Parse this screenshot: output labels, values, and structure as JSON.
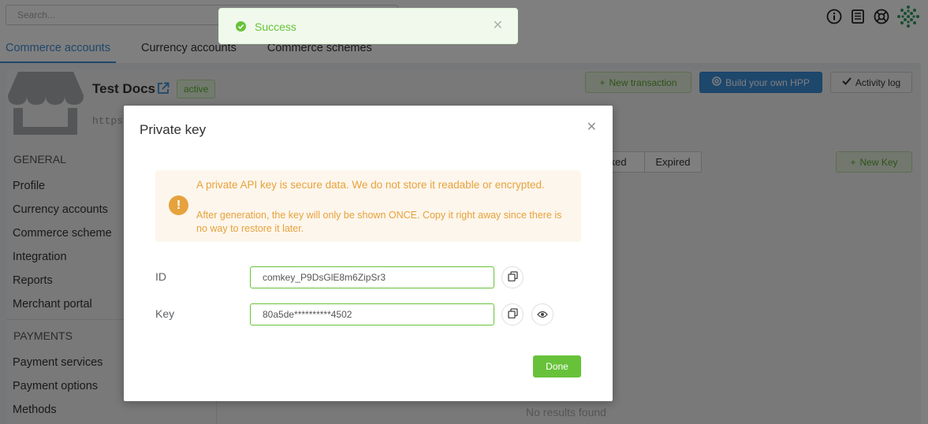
{
  "search": {
    "placeholder": "Search..."
  },
  "top_icons": [
    "info-icon",
    "book-icon",
    "lifebuoy-icon",
    "logo-icon"
  ],
  "tabs": [
    {
      "label": "Commerce accounts",
      "active": true
    },
    {
      "label": "Currency accounts",
      "active": false
    },
    {
      "label": "Commerce schemes",
      "active": false
    }
  ],
  "account": {
    "name": "Test Docs",
    "status": "active",
    "url_fragment": "https"
  },
  "actions": {
    "new_transaction": "New transaction",
    "build_hpp": "Build your own HPP",
    "activity_log": "Activity log"
  },
  "sidebar": {
    "general_title": "GENERAL",
    "general_items": [
      "Profile",
      "Currency accounts",
      "Commerce scheme",
      "Integration",
      "Reports",
      "Merchant portal"
    ],
    "payments_title": "PAYMENTS",
    "payments_items": [
      "Payment services",
      "Payment options",
      "Methods"
    ]
  },
  "keys_panel": {
    "filter_revoked": "oked",
    "filter_expired": "Expired",
    "new_key": "New Key",
    "empty": "No results found"
  },
  "toast": {
    "message": "Success"
  },
  "modal": {
    "title": "Private key",
    "alert_line1": "A private API key is secure data. We do not store it readable or encrypted.",
    "alert_line2": "After generation, the key will only be shown ONCE. Copy it right away since there is no way to restore it later.",
    "id_label": "ID",
    "id_value": "comkey_P9DsGlE8m6ZipSr3",
    "key_label": "Key",
    "key_value": "80a5de**********4502",
    "done_label": "Done"
  },
  "colors": {
    "primary": "#3d8fd8",
    "success": "#67c23a",
    "warning": "#e6a23c",
    "warning_bg": "#fdf6ec"
  }
}
